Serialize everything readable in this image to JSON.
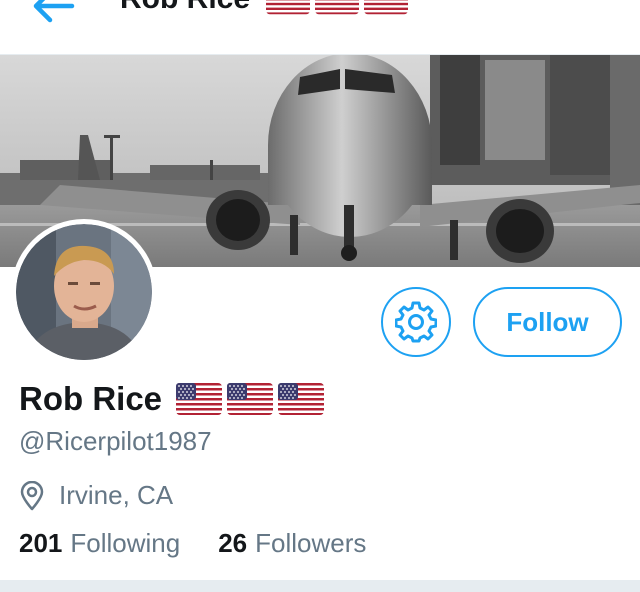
{
  "nav": {
    "title": "Rob Rice",
    "back_icon": "arrow-left-icon"
  },
  "profile": {
    "name": "Rob Rice",
    "flags": [
      "us-flag-icon",
      "us-flag-icon",
      "us-flag-icon"
    ],
    "handle": "@Ricerpilot1987",
    "location": "Irvine, CA",
    "following_count": "201",
    "following_label": "Following",
    "followers_count": "26",
    "followers_label": "Followers"
  },
  "actions": {
    "settings_icon": "gear-icon",
    "follow_label": "Follow"
  },
  "colors": {
    "accent": "#1da1f2",
    "text": "#14171a",
    "secondary_text": "#657786"
  }
}
